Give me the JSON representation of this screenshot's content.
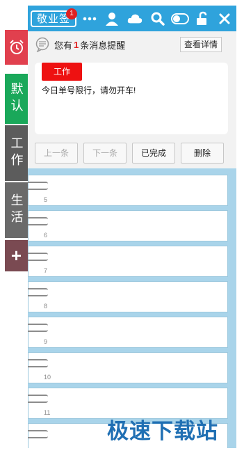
{
  "app": {
    "logo_text": "敬业签",
    "notification_count": "1"
  },
  "toolbar_icons": [
    "more-icon",
    "user-icon",
    "cloud-icon",
    "search-icon",
    "toggle-icon",
    "lock-icon",
    "close-icon"
  ],
  "sidebar": {
    "items": [
      {
        "name": "alarm",
        "label": ""
      },
      {
        "name": "default",
        "label": "默认"
      },
      {
        "name": "work",
        "label": "工作"
      },
      {
        "name": "life",
        "label": "生活"
      },
      {
        "name": "add",
        "label": "+"
      }
    ]
  },
  "reminder": {
    "prefix": "您有",
    "count": "1",
    "suffix": "条消息提醒",
    "detail_button": "查看详情",
    "tag": "工作",
    "text": "今日单号限行，请勿开车!",
    "buttons": {
      "prev": "上一条",
      "next": "下一条",
      "done": "已完成",
      "delete": "删除"
    }
  },
  "note_rows": [
    "5",
    "6",
    "7",
    "8",
    "9",
    "10",
    "11",
    ""
  ],
  "watermark": "极速下载站",
  "colors": {
    "topbar": "#2fa3dc",
    "alarm": "#e1404e",
    "default": "#1aa85a",
    "work": "#5c5c5c",
    "life": "#6a6a6a",
    "add": "#7a4a52",
    "tag": "#ee1111"
  }
}
